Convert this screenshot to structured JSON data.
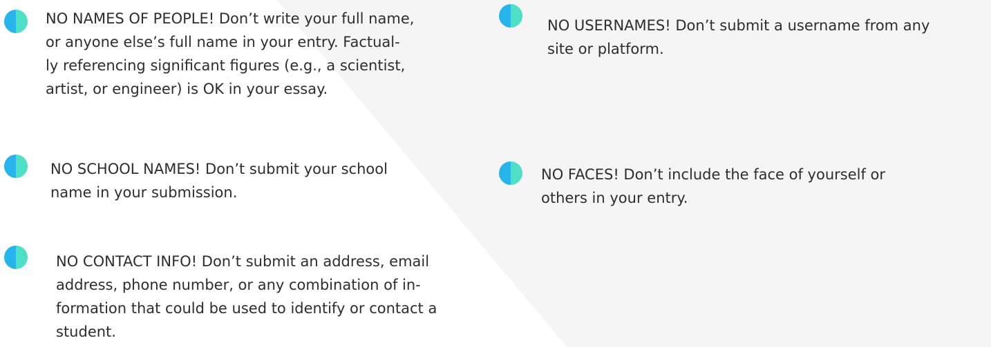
{
  "rules": [
    {
      "text": "NO NAMES OF PEOPLE! Don’t write your full name,\nor anyone else’s full name in your entry. Factual-\nly referencing significant figures (e.g., a scientist,\nartist, or engineer) is OK in your essay."
    },
    {
      "text": "NO USERNAMES! Don’t submit a username from any\nsite or platform."
    },
    {
      "text": "NO SCHOOL NAMES! Don’t submit your school\nname in your submission."
    },
    {
      "text": "NO FACES! Don’t include the face of yourself or\nothers in your entry."
    },
    {
      "text": "NO CONTACT INFO! Don’t submit an address, email\naddress, phone number, or any combination of in-\nformation that could be used to identify or contact a\nstudent."
    }
  ],
  "colors": {
    "bullet_left": "#26b4ea",
    "bullet_right": "#4ee0c6",
    "panel": "#f5f5f5",
    "text": "#2d2d2d"
  }
}
